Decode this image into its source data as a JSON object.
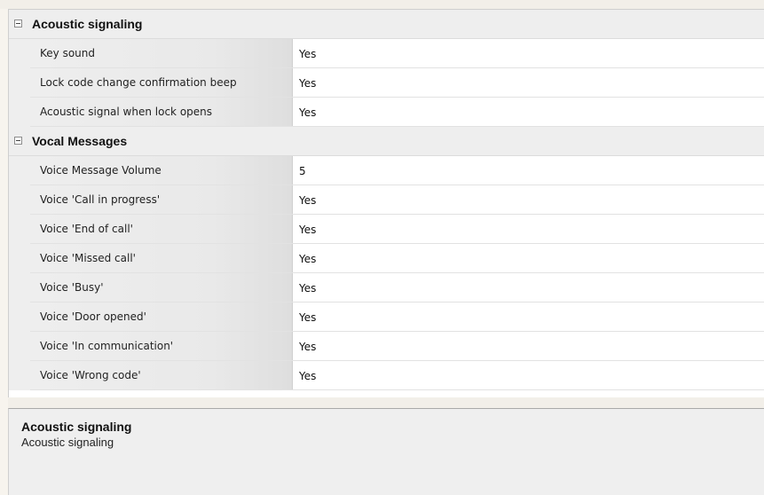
{
  "categories": [
    {
      "label": "Acoustic signaling",
      "properties": [
        {
          "name": "Key sound",
          "value": "Yes"
        },
        {
          "name": "Lock code change confirmation beep",
          "value": "Yes"
        },
        {
          "name": "Acoustic signal when lock opens",
          "value": "Yes"
        }
      ]
    },
    {
      "label": "Vocal Messages",
      "properties": [
        {
          "name": "Voice Message Volume",
          "value": "5"
        },
        {
          "name": "Voice 'Call in progress'",
          "value": "Yes"
        },
        {
          "name": "Voice 'End of call'",
          "value": "Yes"
        },
        {
          "name": "Voice 'Missed call'",
          "value": "Yes"
        },
        {
          "name": "Voice 'Busy'",
          "value": "Yes"
        },
        {
          "name": "Voice 'Door opened'",
          "value": "Yes"
        },
        {
          "name": "Voice 'In communication'",
          "value": "Yes"
        },
        {
          "name": "Voice 'Wrong code'",
          "value": "Yes"
        }
      ]
    }
  ],
  "description": {
    "title": "Acoustic signaling",
    "text": "Acoustic signaling"
  }
}
